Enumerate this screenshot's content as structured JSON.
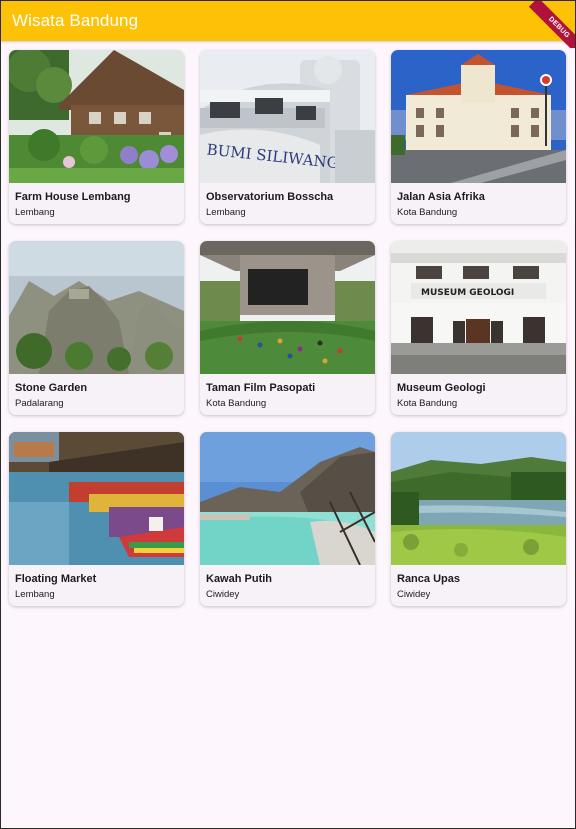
{
  "appbar": {
    "title": "Wisata Bandung",
    "color": "#fdc106",
    "debug_label": "DEBUG"
  },
  "places": [
    {
      "name": "Farm House Lembang",
      "location": "Lembang",
      "image": "wooden-farmhouse-with-garden"
    },
    {
      "name": "Observatorium Bosscha",
      "location": "Lembang",
      "image": "white-art-deco-building"
    },
    {
      "name": "Jalan Asia Afrika",
      "location": "Kota Bandung",
      "image": "colonial-building-street"
    },
    {
      "name": "Stone Garden",
      "location": "Padalarang",
      "image": "rocky-limestone-hill"
    },
    {
      "name": "Taman Film Pasopati",
      "location": "Kota Bandung",
      "image": "park-under-flyover-with-screen"
    },
    {
      "name": "Museum Geologi",
      "location": "Kota Bandung",
      "image": "museum-facade"
    },
    {
      "name": "Floating Market",
      "location": "Lembang",
      "image": "colorful-boats-on-lake"
    },
    {
      "name": "Kawah Putih",
      "location": "Ciwidey",
      "image": "turquoise-crater-lake"
    },
    {
      "name": "Ranca Upas",
      "location": "Ciwidey",
      "image": "lake-with-forest-hills"
    }
  ],
  "museum_sign": "MUSEUM  GEOLOGI",
  "bosscha_sign": "BUMI SILIWANGI"
}
